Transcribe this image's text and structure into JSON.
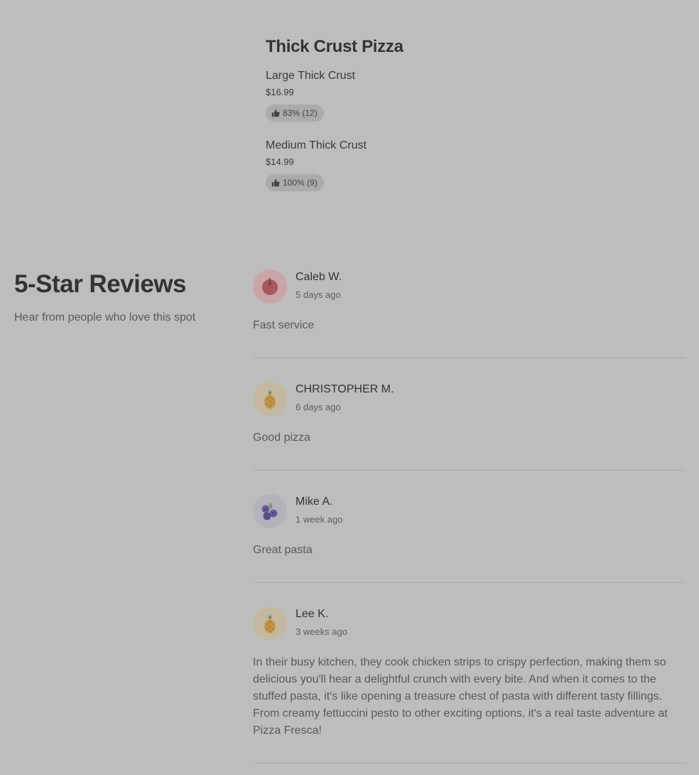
{
  "menu": {
    "title": "Thick Crust Pizza",
    "items": [
      {
        "name": "Large Thick Crust",
        "price": "$16.99",
        "rating": "83% (12)"
      },
      {
        "name": "Medium Thick Crust",
        "price": "$14.99",
        "rating": "100% (9)"
      }
    ]
  },
  "reviews_section": {
    "title": "5-Star Reviews",
    "subtitle": "Hear from people who love this spot"
  },
  "reviews": [
    {
      "name": "Caleb W.",
      "time": "5 days ago",
      "text": "Fast service",
      "avatar_icon": "cherry-icon",
      "avatar_color": "#c9a5a8"
    },
    {
      "name": "CHRISTOPHER M.",
      "time": "6 days ago",
      "text": "Good pizza",
      "avatar_icon": "pineapple-icon",
      "avatar_color": "#c4b9a0"
    },
    {
      "name": "Mike A.",
      "time": "1 week ago",
      "text": "Great pasta",
      "avatar_icon": "blueberry-icon",
      "avatar_color": "#b3b3bb"
    },
    {
      "name": "Lee K.",
      "time": "3 weeks ago",
      "text": "In their busy kitchen, they cook chicken strips to crispy perfection, making them so delicious you'll hear a delightful crunch with every bite. And when it comes to the stuffed pasta, it's like opening a treasure chest of pasta with different tasty fillings. From creamy fettuccini pesto to other exciting options, it's a real taste adventure at Pizza Fresca!",
      "avatar_icon": "pineapple-icon",
      "avatar_color": "#c4b9a0"
    }
  ]
}
